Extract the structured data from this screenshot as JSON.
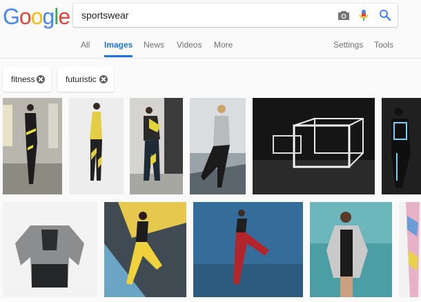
{
  "logo": {
    "letters": [
      "G",
      "o",
      "o",
      "g",
      "l",
      "e"
    ],
    "colors": [
      "#4285F4",
      "#EA4335",
      "#FBBC05",
      "#4285F4",
      "#34A853",
      "#EA4335"
    ]
  },
  "search": {
    "value": "sportswear",
    "camera_icon": "camera-icon",
    "mic_icon": "mic-icon",
    "search_icon": "search-icon"
  },
  "tabs": [
    {
      "label": "All",
      "active": false
    },
    {
      "label": "Images",
      "active": true
    },
    {
      "label": "News",
      "active": false
    },
    {
      "label": "Videos",
      "active": false
    },
    {
      "label": "More",
      "active": false
    },
    {
      "label": "Settings",
      "active": false
    },
    {
      "label": "Tools",
      "active": false
    }
  ],
  "chips": [
    {
      "label": "fitness"
    },
    {
      "label": "futuristic"
    }
  ],
  "colors": {
    "accent": "#1a73e8"
  }
}
